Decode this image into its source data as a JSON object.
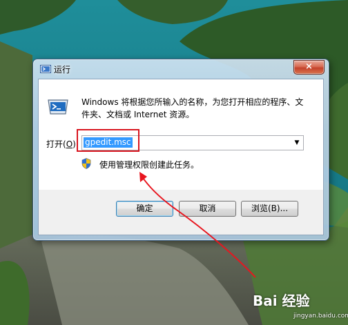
{
  "window": {
    "title": "运行",
    "close_label": "×"
  },
  "dialog": {
    "description": "Windows 将根据您所输入的名称，为您打开相应的程序、文件夹、文档或 Internet 资源。",
    "open_label_prefix": "打开(",
    "open_label_key": "O",
    "open_label_suffix": "):",
    "command_value": "gpedit.msc",
    "admin_note": "使用管理权限创建此任务。"
  },
  "buttons": {
    "ok": "确定",
    "cancel": "取消",
    "browse": "浏览(B)..."
  },
  "watermark": {
    "main": "Bai 经验",
    "sub": "jingyan.baidu.com"
  },
  "colors": {
    "highlight": "#d8141e",
    "selection": "#3399ff"
  }
}
